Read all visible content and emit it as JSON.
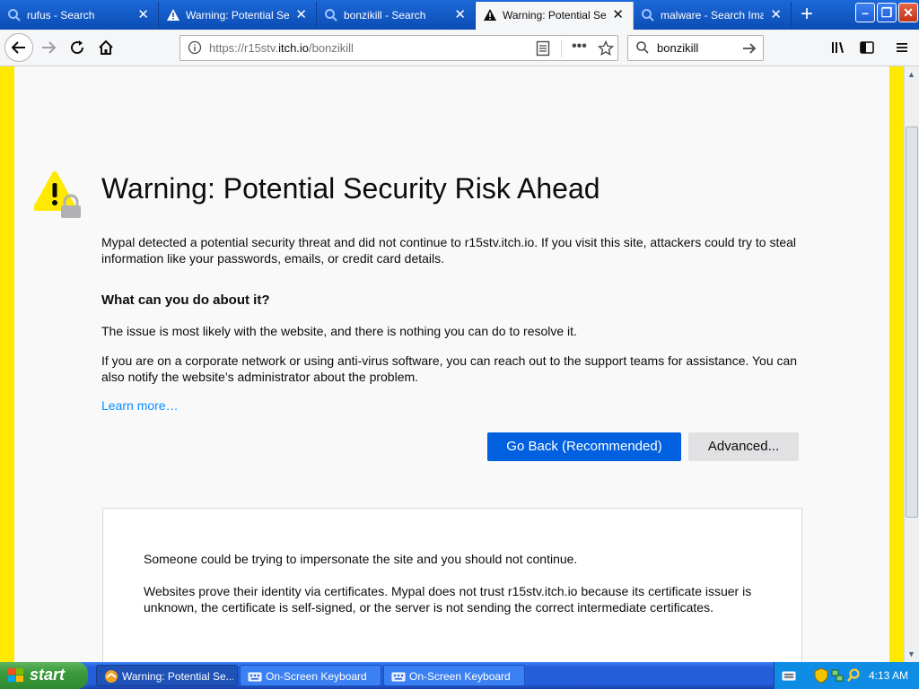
{
  "tabs": [
    {
      "label": "rufus - Search",
      "icon": "search-icon",
      "active": false
    },
    {
      "label": "Warning: Potential Security Risk Ahead",
      "icon": "warning-icon",
      "active": false
    },
    {
      "label": "bonzikill - Search",
      "icon": "search-icon",
      "active": false
    },
    {
      "label": "Warning: Potential Security Risk Ahead",
      "icon": "warning-icon",
      "active": true
    },
    {
      "label": "malware - Search Images",
      "icon": "search-icon",
      "active": false
    }
  ],
  "toolbar": {
    "url_prefix": "https://r15stv.",
    "url_domain": "itch.io",
    "url_path": "/bonzikill",
    "search_value": "bonzikill"
  },
  "page": {
    "title": "Warning: Potential Security Risk Ahead",
    "intro": "Mypal detected a potential security threat and did not continue to r15stv.itch.io. If you visit this site, attackers could try to steal information like your passwords, emails, or credit card details.",
    "what_heading": "What can you do about it?",
    "issue_text": "The issue is most likely with the website, and there is nothing you can do to resolve it.",
    "corporate_text": "If you are on a corporate network or using anti-virus software, you can reach out to the support teams for assistance. You can also notify the website’s administrator about the problem.",
    "learn_more": "Learn more…",
    "go_back": "Go Back (Recommended)",
    "advanced": "Advanced...",
    "advanced_panel": {
      "impersonate": "Someone could be trying to impersonate the site and you should not continue.",
      "certificates": "Websites prove their identity via certificates. Mypal does not trust r15stv.itch.io because its certificate issuer is unknown, the certificate is self-signed, or the server is not sending the correct intermediate certificates."
    }
  },
  "taskbar": {
    "start": "start",
    "tasks": [
      {
        "label": "Warning: Potential Se...",
        "active": true
      },
      {
        "label": "On-Screen Keyboard",
        "active": false
      },
      {
        "label": "On-Screen Keyboard",
        "active": false
      }
    ],
    "clock": "4:13 AM"
  },
  "colors": {
    "tabbar": "#0b4db4",
    "warning_stripe": "#ffe900",
    "primary_button": "#0060df",
    "link": "#0a8dff"
  }
}
